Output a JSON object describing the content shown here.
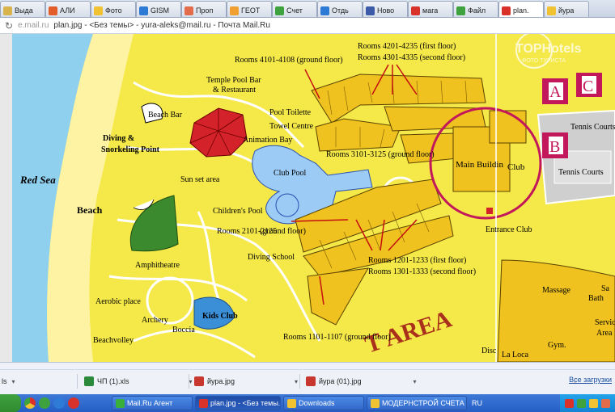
{
  "browser": {
    "tabs": [
      {
        "label": "Выда",
        "color": "#d9b44a"
      },
      {
        "label": "АЛИ",
        "color": "#e35d2a"
      },
      {
        "label": "Фото",
        "color": "#f1c232"
      },
      {
        "label": "GISM",
        "color": "#2e7bd6"
      },
      {
        "label": "Проп",
        "color": "#e36c4a"
      },
      {
        "label": "ГЕОТ",
        "color": "#f0a030"
      },
      {
        "label": "Счет",
        "color": "#3ea33e"
      },
      {
        "label": "Отдь",
        "color": "#2e7bd6"
      },
      {
        "label": "Ново",
        "color": "#3b5ba8"
      },
      {
        "label": "мага",
        "color": "#d8322b"
      },
      {
        "label": "Файл",
        "color": "#3ea33e"
      },
      {
        "label": "plan.",
        "color": "#d8322b"
      },
      {
        "label": "йура",
        "color": "#f1c232"
      }
    ],
    "active_tab": 11,
    "address": {
      "domain": "e.mail.ru",
      "title": "plan.jpg - <Без темы> - yura-aleks@mail.ru - Почта Mail.Ru"
    }
  },
  "watermark": {
    "brand": "TOPHotels",
    "sub": "ФОТО ТУРИСТА"
  },
  "map": {
    "sea": "Red Sea",
    "beach": "Beach",
    "diving": "Diving &",
    "diving2": "Snorkeling Point",
    "beach_bar": "Beach Bar",
    "temple_bar": "Temple Pool Bar",
    "temple_bar2": "& Restaurant",
    "pool_toilette": "Pool Toilette",
    "towel_centre": "Towel Centre",
    "animation": "Animation Bay",
    "club_pool": "Club Pool",
    "sunset": "Sun set area",
    "childrens_pool": "Children's Pool",
    "rooms_2101": "Rooms 2101-2125",
    "ground_floor": "(ground floor)",
    "amphitheatre": "Amphitheatre",
    "diving_school": "Diving School",
    "aerobic": "Aerobic place",
    "archery": "Archery",
    "kids_club": "Kids Club",
    "boccia": "Boccia",
    "beachvolley": "Beachvolley",
    "rooms_4101": "Rooms 4101-4108 (ground floor)",
    "rooms_4201": "Rooms 4201-4235 (first floor)",
    "rooms_4301": "Rooms 4301-4335 (second floor)",
    "rooms_3101": "Rooms 3101-3125 (ground floor)",
    "main_building": "Main Buildin",
    "club": "Club",
    "entrance": "Entrance Club",
    "tennis1": "Tennis Courts",
    "tennis2": "Tennis Courts",
    "rooms_1201": "Rooms 1201-1233 (first floor)",
    "rooms_1301": "Rooms 1301-1333 (second floor)",
    "rooms_1101": "Rooms 1101-1107 (ground floor)",
    "area_text": "T AREA",
    "massage": "Massage",
    "sa": "Sa",
    "bath": "Bath",
    "service": "Service",
    "area": "Area",
    "gym": "Gym.",
    "disco": "Disc",
    "la_loca": "La Loca",
    "letter_a": "A",
    "letter_b": "B",
    "letter_c": "C",
    "colors": {
      "land": "#f5e94a",
      "sea": "#8fd0ef",
      "sand": "#fef3a3",
      "building": "#f0c21f",
      "pool": "#9ccbf5",
      "red": "#d4222a",
      "green": "#3c8a2e",
      "magenta": "#c2185b"
    }
  },
  "downloads": {
    "items": [
      {
        "label": "ls",
        "color": "#2a8a3a"
      },
      {
        "label": "ЧП (1).xls",
        "color": "#2a8a3a"
      },
      {
        "label": "йура.jpg",
        "color": "#c8372d"
      },
      {
        "label": "йура (01).jpg",
        "color": "#c8372d"
      }
    ],
    "show_all": "Все загрузки"
  },
  "taskbar": {
    "buttons": [
      {
        "label": "Mail.Ru Агент",
        "color": "#38b03a"
      },
      {
        "label": "plan.jpg - <Без темы...",
        "color": "#d8322b"
      },
      {
        "label": "Downloads",
        "color": "#f1c232"
      },
      {
        "label": "МОДЕРНСТРОЙ СЧЕТА",
        "color": "#f1c232"
      }
    ],
    "lang": "RU",
    "active_button": 1
  }
}
